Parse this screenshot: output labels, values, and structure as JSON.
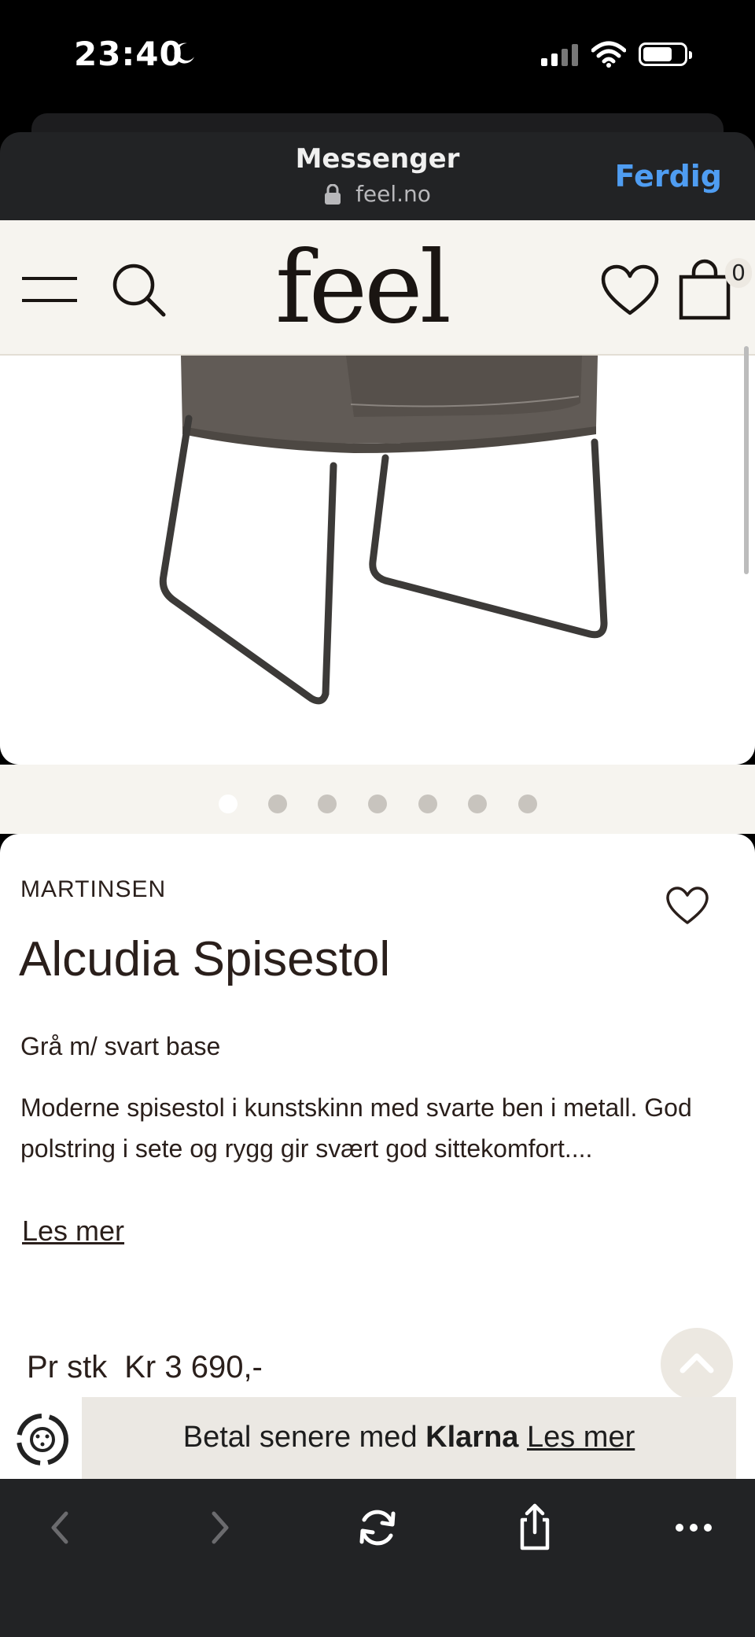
{
  "status_bar": {
    "time": "23:40"
  },
  "sheet": {
    "title": "Messenger",
    "url": "feel.no",
    "done_label": "Ferdig"
  },
  "site": {
    "logo": "feel",
    "cart_count": "0"
  },
  "gallery": {
    "total_images": 7,
    "active_index": 0
  },
  "product": {
    "brand": "MARTINSEN",
    "title": "Alcudia Spisestol",
    "variant": "Grå m/ svart base",
    "description": "Moderne spisestol i kunstskinn med svarte ben i metall. God polstring i sete og rygg gir svært god sittekomfort....",
    "read_more": "Les mer",
    "price_label": "Pr stk",
    "price": "Kr 3 690,-"
  },
  "klarna": {
    "prefix": "Betal senere med",
    "brand": "Klarna",
    "link": "Les mer"
  },
  "colors": {
    "accent": "#4f9df2",
    "header_bg": "#f6f4ef",
    "text": "#2a1f1b"
  }
}
